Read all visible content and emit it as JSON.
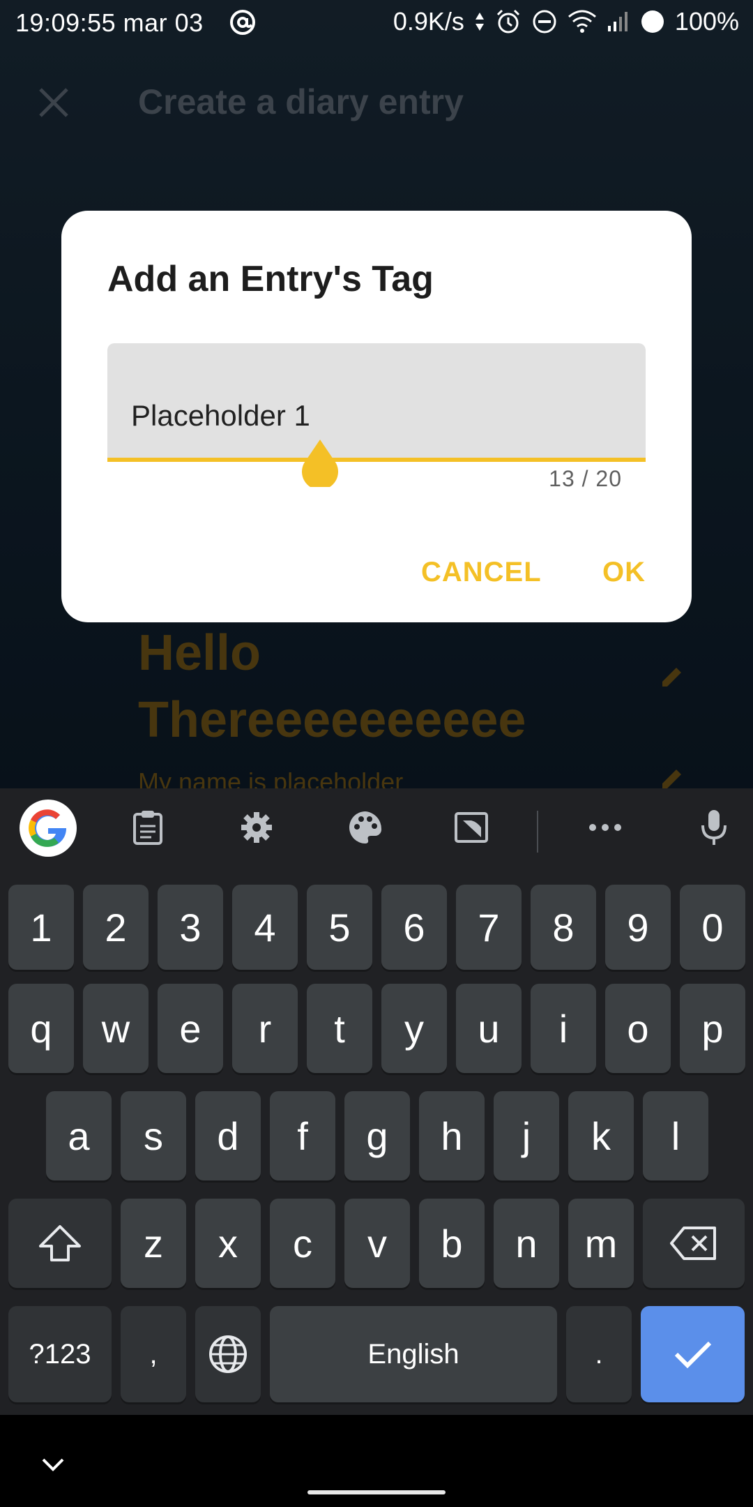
{
  "status_bar": {
    "time": "19:09:55 mar 03",
    "net_speed": "0.9K/s",
    "battery": "100%"
  },
  "app": {
    "title": "Create a diary entry",
    "entry_title": "Hello Thereeeeeeeeee",
    "entry_body": "My name is placeholder"
  },
  "dialog": {
    "title": "Add an Entry's Tag",
    "input_value": "Placeholder 1",
    "counter": "13 / 20",
    "cancel_label": "CANCEL",
    "ok_label": "OK",
    "accent_color": "#f4c026"
  },
  "keyboard": {
    "row_numbers": [
      "1",
      "2",
      "3",
      "4",
      "5",
      "6",
      "7",
      "8",
      "9",
      "0"
    ],
    "row_top": [
      "q",
      "w",
      "e",
      "r",
      "t",
      "y",
      "u",
      "i",
      "o",
      "p"
    ],
    "row_middle": [
      "a",
      "s",
      "d",
      "f",
      "g",
      "h",
      "j",
      "k",
      "l"
    ],
    "row_bottom": [
      "z",
      "x",
      "c",
      "v",
      "b",
      "n",
      "m"
    ],
    "symbols_label": "?123",
    "comma_label": ",",
    "space_label": "English",
    "period_label": ".",
    "enter_color": "#5b8fea"
  }
}
